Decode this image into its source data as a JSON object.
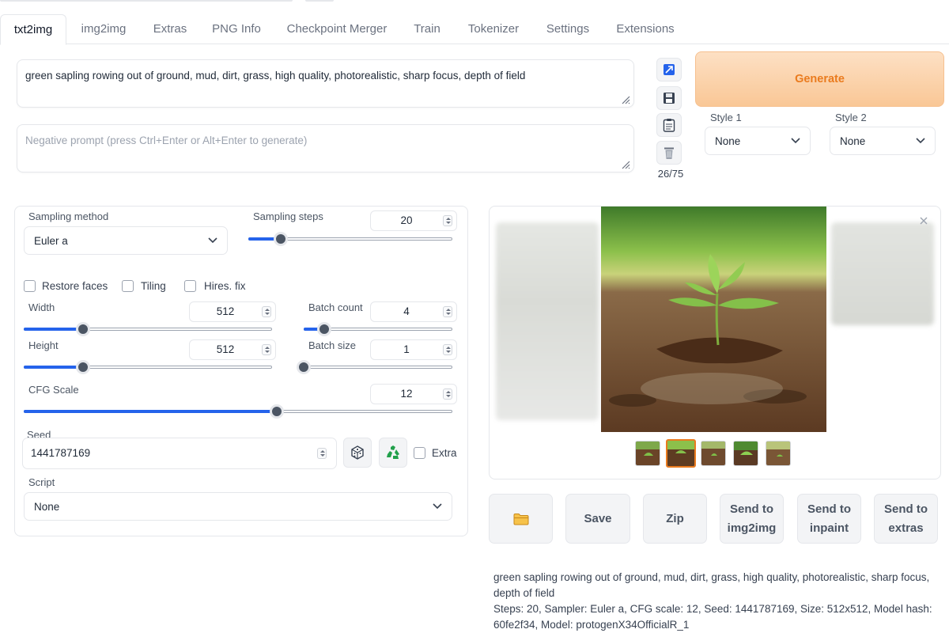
{
  "tabs": [
    "txt2img",
    "img2img",
    "Extras",
    "PNG Info",
    "Checkpoint Merger",
    "Train",
    "Tokenizer",
    "Settings",
    "Extensions"
  ],
  "active_tab": "txt2img",
  "prompt": {
    "value": "green sapling rowing out of ground, mud, dirt, grass, high quality, photorealistic, sharp focus, depth of field",
    "negative_placeholder": "Negative prompt (press Ctrl+Enter or Alt+Enter to generate)",
    "token_count": "26/75"
  },
  "generate": {
    "label": "Generate"
  },
  "styles": {
    "style1": {
      "label": "Style 1",
      "value": "None"
    },
    "style2": {
      "label": "Style 2",
      "value": "None"
    }
  },
  "settings": {
    "sampling_method": {
      "label": "Sampling method",
      "value": "Euler a"
    },
    "sampling_steps": {
      "label": "Sampling steps",
      "value": "20",
      "fraction": 0.16
    },
    "checkboxes": {
      "restore_faces": "Restore faces",
      "tiling": "Tiling",
      "hires_fix": "Hires. fix"
    },
    "width": {
      "label": "Width",
      "value": "512",
      "fraction": 0.24
    },
    "height": {
      "label": "Height",
      "value": "512",
      "fraction": 0.24
    },
    "batch_count": {
      "label": "Batch count",
      "value": "4",
      "fraction": 0.14
    },
    "batch_size": {
      "label": "Batch size",
      "value": "1",
      "fraction": 0.0
    },
    "cfg_scale": {
      "label": "CFG Scale",
      "value": "12",
      "fraction": 0.59
    },
    "seed": {
      "label": "Seed",
      "value": "1441787169",
      "extra_label": "Extra"
    },
    "script": {
      "label": "Script",
      "value": "None"
    }
  },
  "actions": {
    "folder": "folder-icon",
    "save": "Save",
    "zip": "Zip",
    "send_img2img_1": "Send to",
    "send_img2img_2": "img2img",
    "send_inpaint_1": "Send to",
    "send_inpaint_2": "inpaint",
    "send_extras_1": "Send to",
    "send_extras_2": "extras"
  },
  "generation_info": {
    "prompt_line": "green sapling rowing out of ground, mud, dirt, grass, high quality, photorealistic, sharp focus, depth of field",
    "params_line": "Steps: 20, Sampler: Euler a, CFG scale: 12, Seed: 1441787169, Size: 512x512, Model hash: 60fe2f34, Model: protogenX34OfficialR_1"
  },
  "colors": {
    "accent": "#2563eb",
    "generate_text": "#ea7b1e",
    "generate_bg": "#fbd3ac"
  }
}
